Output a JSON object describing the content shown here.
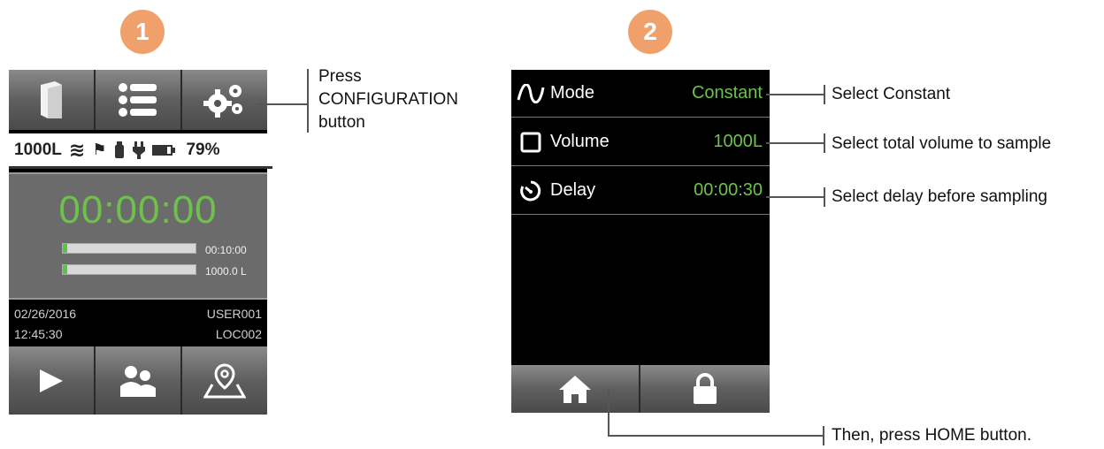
{
  "steps": {
    "one": "1",
    "two": "2"
  },
  "device1": {
    "status": {
      "volume": "1000L",
      "battery_pct": "79%"
    },
    "timer": "00:00:00",
    "progress": [
      {
        "label": "00:10:00",
        "fill": 0.03
      },
      {
        "label": "1000.0 L",
        "fill": 0.03
      }
    ],
    "info": {
      "date": "02/26/2016",
      "user": "USER001",
      "time": "12:45:30",
      "location": "LOC002"
    }
  },
  "device2": {
    "rows": [
      {
        "label": "Mode",
        "value": "Constant"
      },
      {
        "label": "Volume",
        "value": "1000L"
      },
      {
        "label": "Delay",
        "value": "00:00:30"
      }
    ]
  },
  "callouts": {
    "press_config_1": "Press",
    "press_config_2": "CONFIGURATION",
    "press_config_3": "button",
    "select_constant": "Select Constant",
    "select_volume": "Select total volume to sample",
    "select_delay": "Select delay before sampling",
    "press_home": "Then, press HOME button."
  },
  "colors": {
    "accent_green": "#6cc24a",
    "badge": "#f0a06a"
  }
}
